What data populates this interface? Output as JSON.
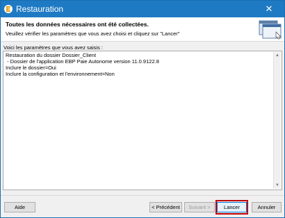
{
  "window": {
    "title": "Restauration",
    "close_icon": "close-icon"
  },
  "header": {
    "title": "Toutes les données nécessaires ont été collectées.",
    "subtitle": "Veuillez vérifier les paramètres que vous avez choisi et cliquez sur \"Lancer\""
  },
  "content": {
    "label": "Voici les paramètres que vous avez saisis :",
    "lines": [
      "Restauration du dossier Dossier_Client",
      " - Dossier de l'application EBP Paie Autonome version 11.0.9122.8",
      "Inclure le dossier=Oui",
      "Inclure la configuration et l'environnement=Non"
    ]
  },
  "buttons": {
    "help": "Aide",
    "previous": "< Précédent",
    "next": "Suivant >",
    "launch": "Lancer",
    "cancel": "Annuler"
  },
  "colors": {
    "titlebar": "#1f7ac4",
    "highlight": "#c00000"
  }
}
